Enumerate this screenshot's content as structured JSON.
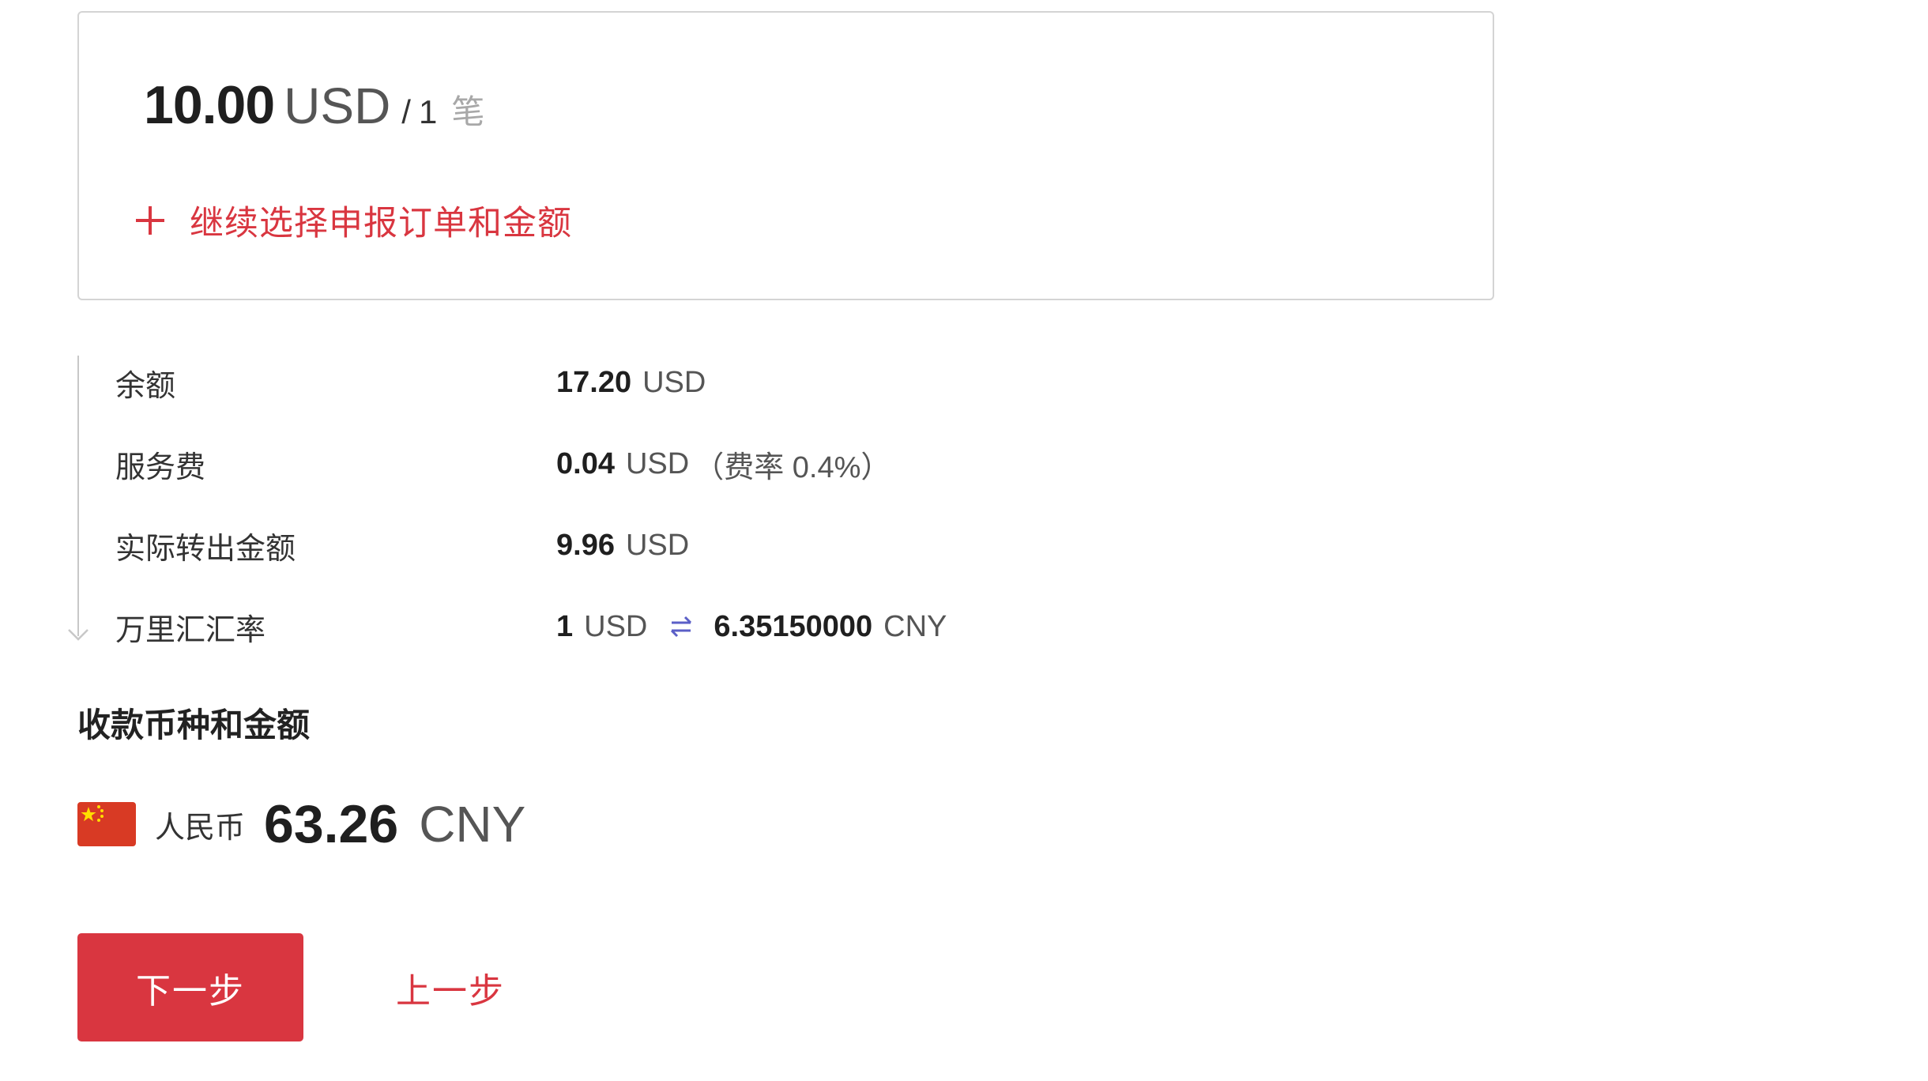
{
  "order_card": {
    "amount": "10.00",
    "currency": "USD",
    "separator": "/",
    "count": "1",
    "count_unit": "笔",
    "add_order_label": "继续选择申报订单和金额"
  },
  "details": {
    "balance": {
      "label": "余额",
      "value": "17.20",
      "currency": "USD"
    },
    "service_fee": {
      "label": "服务费",
      "value": "0.04",
      "currency": "USD",
      "note": "（费率 0.4%）"
    },
    "actual_out": {
      "label": "实际转出金额",
      "value": "9.96",
      "currency": "USD"
    },
    "exchange_rate": {
      "label": "万里汇汇率",
      "from_value": "1",
      "from_currency": "USD",
      "to_value": "6.35150000",
      "to_currency": "CNY"
    }
  },
  "receive": {
    "title": "收款币种和金额",
    "currency_name": "人民币",
    "amount": "63.26",
    "currency_code": "CNY",
    "flag_icon": "china-flag-icon"
  },
  "actions": {
    "next_label": "下一步",
    "prev_label": "上一步"
  },
  "colors": {
    "accent": "#d93640",
    "exchange_icon": "#5b5fc7",
    "flag_red": "#d83a24",
    "flag_star": "#ffde00",
    "border": "#d4d4d4"
  }
}
